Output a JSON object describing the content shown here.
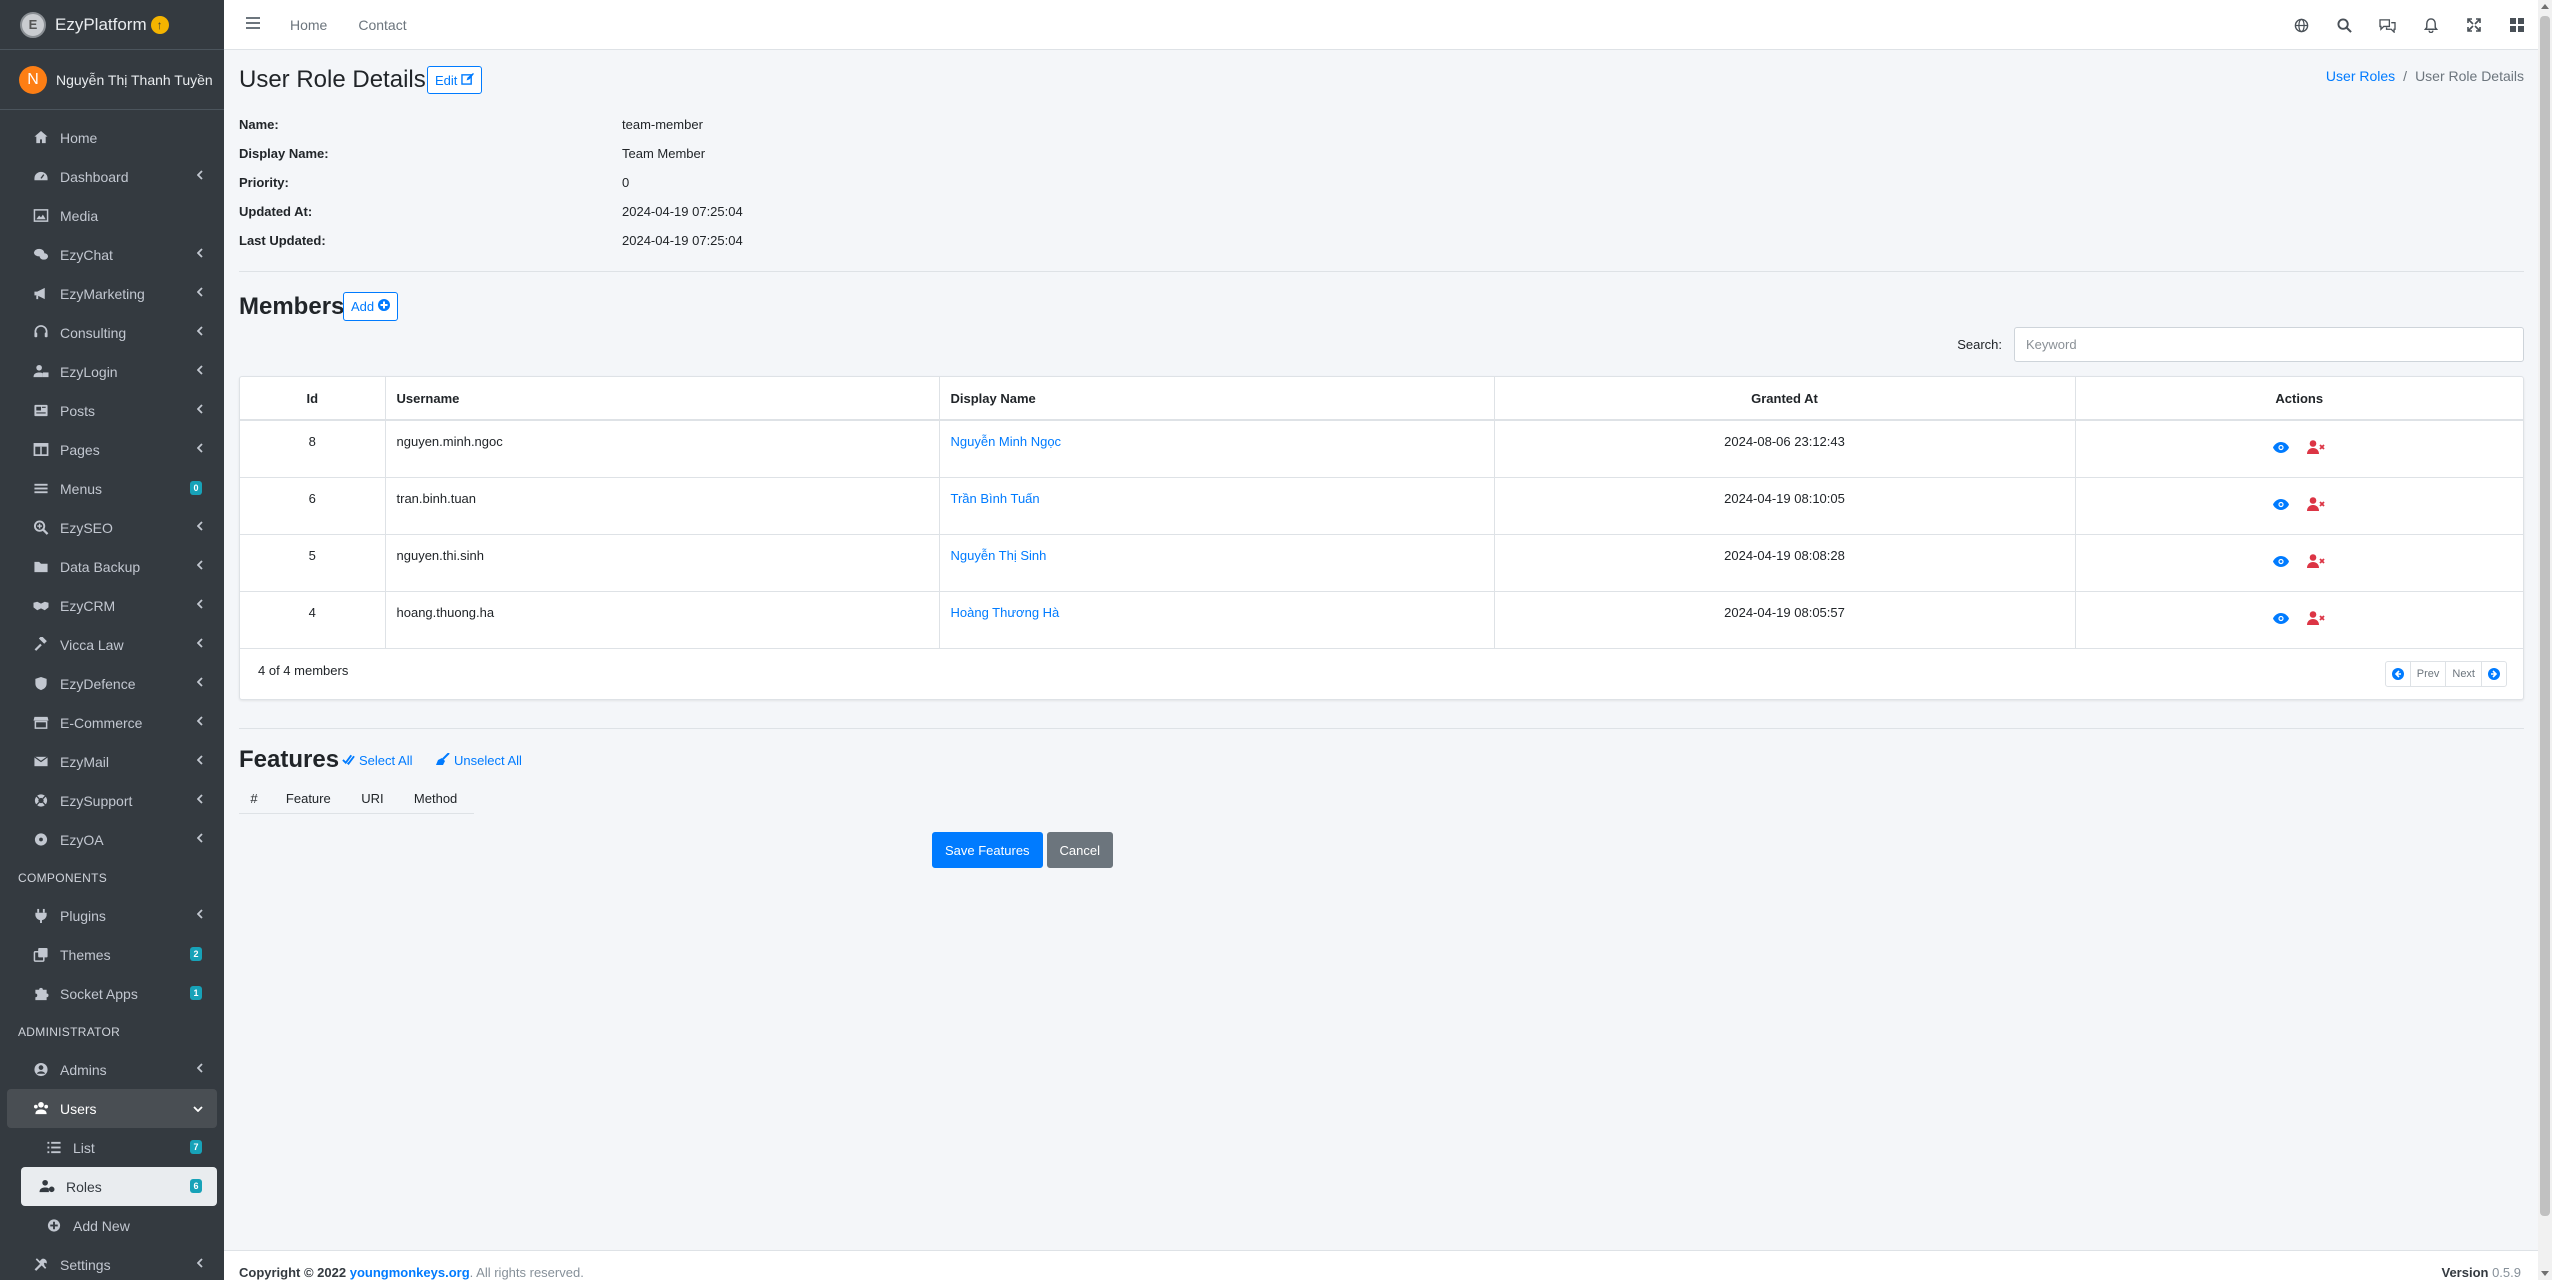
{
  "brand": {
    "name": "EzyPlatform"
  },
  "user": {
    "initial": "N",
    "name": "Nguyễn Thị Thanh Tuyền"
  },
  "sidebar": {
    "items": [
      {
        "label": "Home",
        "icon": "home-icon",
        "chevron": false
      },
      {
        "label": "Dashboard",
        "icon": "dashboard-icon",
        "chevron": true
      },
      {
        "label": "Media",
        "icon": "image-icon",
        "chevron": false
      },
      {
        "label": "EzyChat",
        "icon": "chat-icon",
        "chevron": true
      },
      {
        "label": "EzyMarketing",
        "icon": "megaphone-icon",
        "chevron": true
      },
      {
        "label": "Consulting",
        "icon": "headset-icon",
        "chevron": true
      },
      {
        "label": "EzyLogin",
        "icon": "user-lock-icon",
        "chevron": true
      },
      {
        "label": "Posts",
        "icon": "newspaper-icon",
        "chevron": true
      },
      {
        "label": "Pages",
        "icon": "columns-icon",
        "chevron": true
      },
      {
        "label": "Menus",
        "icon": "bars-icon",
        "badge": "0"
      },
      {
        "label": "EzySEO",
        "icon": "search-plus-icon",
        "chevron": true
      },
      {
        "label": "Data Backup",
        "icon": "folder-icon",
        "chevron": true
      },
      {
        "label": "EzyCRM",
        "icon": "handshake-icon",
        "chevron": true
      },
      {
        "label": "Vicca Law",
        "icon": "gavel-icon",
        "chevron": true
      },
      {
        "label": "EzyDefence",
        "icon": "shield-icon",
        "chevron": true
      },
      {
        "label": "E-Commerce",
        "icon": "shop-icon",
        "chevron": true
      },
      {
        "label": "EzyMail",
        "icon": "envelope-icon",
        "chevron": true
      },
      {
        "label": "EzySupport",
        "icon": "lifebuoy-icon",
        "chevron": true
      },
      {
        "label": "EzyOA",
        "icon": "circle-dots-icon",
        "chevron": true
      }
    ],
    "components_header": "COMPONENTS",
    "components": [
      {
        "label": "Plugins",
        "icon": "plug-icon",
        "chevron": true
      },
      {
        "label": "Themes",
        "icon": "clone-icon",
        "badge": "2"
      },
      {
        "label": "Socket Apps",
        "icon": "puzzle-icon",
        "badge": "1"
      }
    ],
    "admin_header": "ADMINISTRATOR",
    "admin": [
      {
        "label": "Admins",
        "icon": "user-circle-icon",
        "chevron": true
      },
      {
        "label": "Users",
        "icon": "users-icon",
        "chevron_down": true
      }
    ],
    "users_sub": [
      {
        "label": "List",
        "icon": "list-icon",
        "badge": "7"
      },
      {
        "label": "Roles",
        "icon": "users-cog-icon",
        "badge": "6",
        "active": true
      },
      {
        "label": "Add New",
        "icon": "plus-circle-icon"
      }
    ],
    "settings": {
      "label": "Settings",
      "icon": "tools-icon"
    }
  },
  "topnav": {
    "home": "Home",
    "contact": "Contact"
  },
  "page": {
    "title": "User Role Details",
    "edit_label": "Edit",
    "breadcrumb": {
      "parent": "User Roles",
      "current": "User Role Details"
    }
  },
  "details": [
    {
      "label": "Name:",
      "value": "team-member"
    },
    {
      "label": "Display Name:",
      "value": "Team Member"
    },
    {
      "label": "Priority:",
      "value": "0"
    },
    {
      "label": "Updated At:",
      "value": "2024-04-19 07:25:04"
    },
    {
      "label": "Last Updated:",
      "value": "2024-04-19 07:25:04"
    }
  ],
  "members": {
    "title": "Members",
    "add_label": "Add",
    "search_label": "Search:",
    "search_placeholder": "Keyword",
    "columns": [
      "Id",
      "Username",
      "Display Name",
      "Granted At",
      "Actions"
    ],
    "rows": [
      {
        "id": "8",
        "username": "nguyen.minh.ngoc",
        "display_name": "Nguyễn Minh Ngọc",
        "granted_at": "2024-08-06 23:12:43"
      },
      {
        "id": "6",
        "username": "tran.binh.tuan",
        "display_name": "Trần Bình Tuấn",
        "granted_at": "2024-04-19 08:10:05"
      },
      {
        "id": "5",
        "username": "nguyen.thi.sinh",
        "display_name": "Nguyễn Thị Sinh",
        "granted_at": "2024-04-19 08:08:28"
      },
      {
        "id": "4",
        "username": "hoang.thuong.ha",
        "display_name": "Hoàng Thương Hà",
        "granted_at": "2024-04-19 08:05:57"
      }
    ],
    "count_text": "4 of 4 members",
    "pager": {
      "prev": "Prev",
      "next": "Next"
    }
  },
  "features": {
    "title": "Features",
    "select_all": "Select All",
    "unselect_all": "Unselect All",
    "columns": [
      "#",
      "Feature",
      "URI",
      "Method"
    ],
    "save_label": "Save Features",
    "cancel_label": "Cancel"
  },
  "footer": {
    "copyright": "Copyright © 2022",
    "site": "youngmonkeys.org",
    "rights": ". All rights reserved.",
    "version_label": "Version",
    "version": "0.5.9"
  },
  "colors": {
    "primary": "#007bff",
    "sidebar": "#343a40",
    "danger": "#dc3545",
    "badge": "#17a2b8"
  }
}
